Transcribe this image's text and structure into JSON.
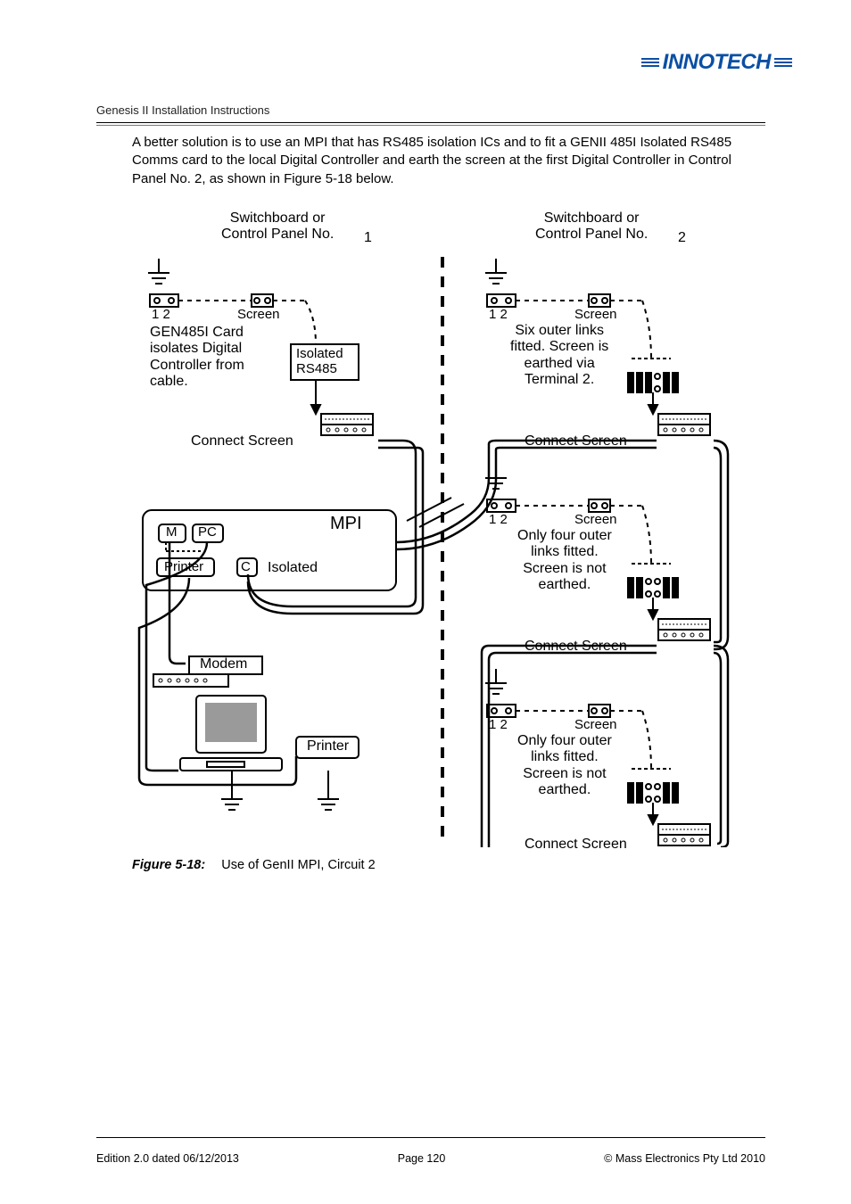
{
  "logo": {
    "text": "INNOTECH"
  },
  "header": {
    "doc_title": "Genesis II Installation Instructions"
  },
  "body": {
    "paragraph": "A better solution is to use an MPI that has RS485 isolation ICs and to fit a GENII 485I Isolated RS485 Comms card to the local Digital Controller and earth the screen at the first Digital Controller in Control Panel No. 2, as shown in Figure 5-18 below."
  },
  "figure": {
    "caption_label": "Figure 5-18:",
    "caption_text": "Use of GenII MPI, Circuit 2",
    "panel_left": {
      "title": "Switchboard or\nControl Panel No.",
      "number": "1",
      "term12": "1 2",
      "screen": "Screen",
      "card_text": "GEN485I Card\nisolates Digital\nController from\ncable.",
      "iso_box": "Isolated\nRS485",
      "connect": "Connect Screen"
    },
    "panel_right": {
      "title": "Switchboard or\nControl Panel No.",
      "number": "2"
    },
    "right_dc": [
      {
        "term12": "1 2",
        "screen": "Screen",
        "text": "Six outer links\nfitted. Screen is\nearthed via\nTerminal 2.",
        "connect": "Connect Screen"
      },
      {
        "term12": "1 2",
        "screen": "Screen",
        "text": "Only four outer\nlinks fitted.\nScreen is not\nearthed.",
        "connect": "Connect Screen"
      },
      {
        "term12": "1 2",
        "screen": "Screen",
        "text": "Only four outer\nlinks fitted.\nScreen is not\nearthed.",
        "connect": "Connect Screen"
      }
    ],
    "mpi": {
      "title": "MPI",
      "m": "M",
      "pc": "PC",
      "printer": "Printer",
      "c": "C",
      "iso": "Isolated"
    },
    "modem": {
      "label": "Modem"
    },
    "pc_printer": {
      "label": "Printer"
    }
  },
  "footer": {
    "left": "Edition 2.0 dated 06/12/2013",
    "center": "Page 120",
    "right": "©  Mass Electronics Pty Ltd  2010"
  }
}
